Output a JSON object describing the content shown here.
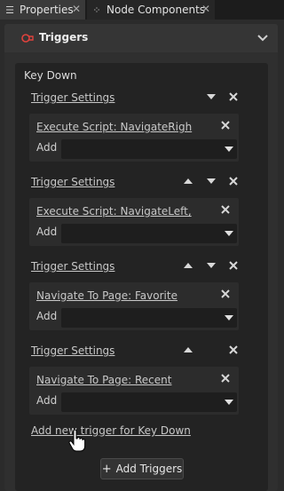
{
  "tabs": [
    {
      "label": "Properties",
      "icon": "list-icon"
    },
    {
      "label": "Node Components",
      "icon": "components-icon"
    }
  ],
  "tab_close_glyph": "✕",
  "section": {
    "title": "Triggers",
    "icon": "trigger-icon",
    "accent": "#e0423d"
  },
  "event": {
    "title": "Key Down"
  },
  "triggers": [
    {
      "label": "Trigger Settings",
      "action": "Execute Script: NavigateRigh",
      "add": "Add"
    },
    {
      "label": "Trigger Settings",
      "action": "Execute Script: NavigateLeft,",
      "add": "Add"
    },
    {
      "label": "Trigger Settings",
      "action": "Navigate To Page: Favorite",
      "add": "Add"
    },
    {
      "label": "Trigger Settings",
      "action": "Navigate To Page: Recent",
      "add": "Add"
    }
  ],
  "add_new_link": "Add new trigger for Key Down",
  "add_triggers_button": {
    "plus": "+",
    "label": "Add Triggers"
  }
}
